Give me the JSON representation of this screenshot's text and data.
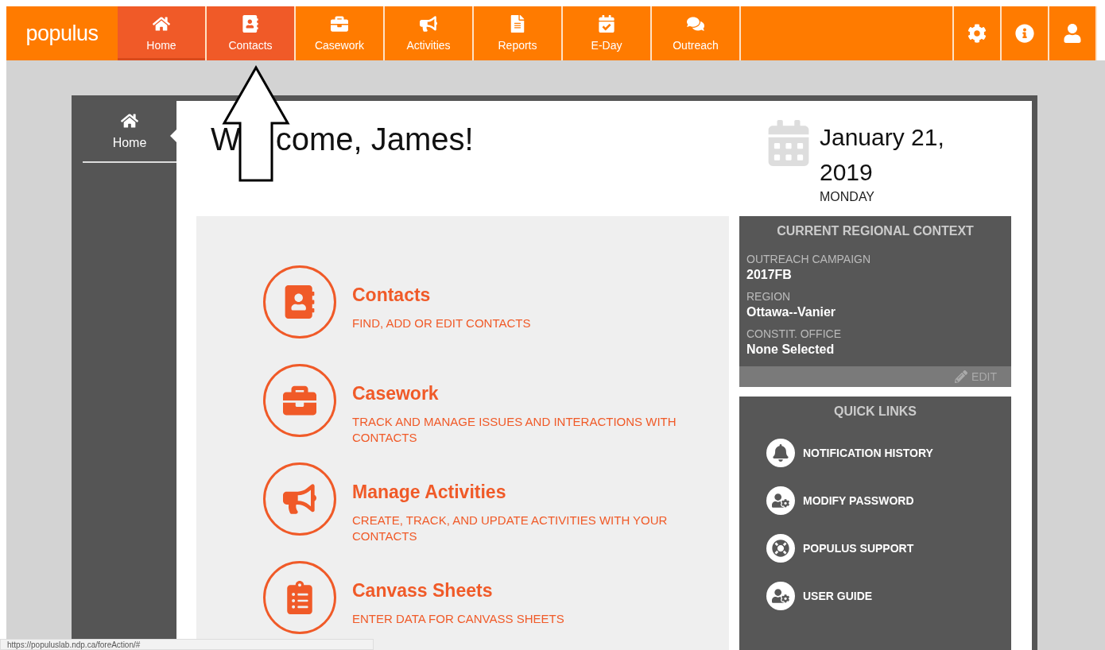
{
  "navbar": {
    "logo": "populus",
    "tabs": [
      {
        "label": "Home",
        "selected": true,
        "highlighted": true
      },
      {
        "label": "Contacts",
        "selected": false,
        "highlighted": true
      },
      {
        "label": "Casework",
        "selected": false,
        "highlighted": false
      },
      {
        "label": "Activities",
        "selected": false,
        "highlighted": false
      },
      {
        "label": "Reports",
        "selected": false,
        "highlighted": false
      },
      {
        "label": "E-Day",
        "selected": false,
        "highlighted": false
      },
      {
        "label": "Outreach",
        "selected": false,
        "highlighted": false
      }
    ]
  },
  "sidebar": {
    "items": [
      {
        "label": "Home",
        "selected": true
      }
    ]
  },
  "welcome": {
    "start": "W",
    "end": "come, James!"
  },
  "date": {
    "line_1": "January 21,",
    "line_2": "2019",
    "weekday": "MONDAY"
  },
  "modules": [
    {
      "title": "Contacts",
      "description": "FIND, ADD OR EDIT CONTACTS"
    },
    {
      "title": "Casework",
      "description": "TRACK AND MANAGE ISSUES AND INTERACTIONS WITH CONTACTS"
    },
    {
      "title": "Manage Activities",
      "description": "CREATE, TRACK, AND UPDATE ACTIVITIES WITH YOUR CONTACTS"
    },
    {
      "title": "Canvass Sheets",
      "description": "ENTER DATA FOR CANVASS SHEETS"
    }
  ],
  "regional_context": {
    "title": "CURRENT REGIONAL CONTEXT",
    "fields": [
      {
        "label": "OUTREACH CAMPAIGN",
        "value": "2017FB"
      },
      {
        "label": "REGION",
        "value": "Ottawa--Vanier"
      },
      {
        "label": "CONSTIT. OFFICE",
        "value": "None Selected"
      }
    ],
    "edit_label": "EDIT"
  },
  "quick_links": {
    "title": "QUICK LINKS",
    "items": [
      {
        "label": "NOTIFICATION HISTORY"
      },
      {
        "label": "MODIFY PASSWORD"
      },
      {
        "label": "POPULUS SUPPORT"
      },
      {
        "label": "USER GUIDE"
      }
    ]
  },
  "status_bar": {
    "url": "https://populuslab.ndp.ca/foreAction/#"
  }
}
